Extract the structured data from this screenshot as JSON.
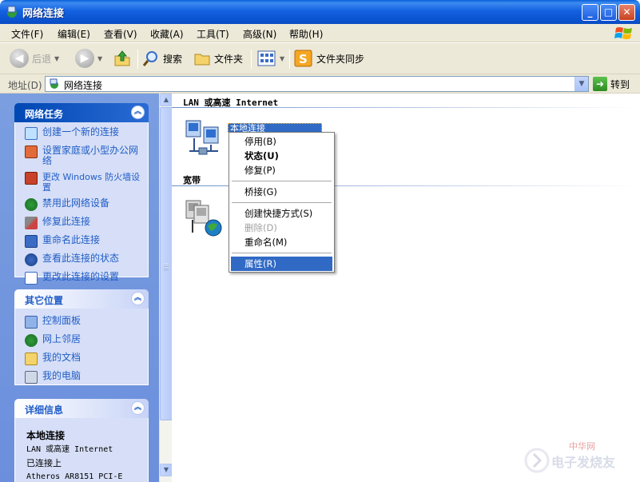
{
  "window": {
    "title": "网络连接"
  },
  "menu": [
    "文件(F)",
    "编辑(E)",
    "查看(V)",
    "收藏(A)",
    "工具(T)",
    "高级(N)",
    "帮助(H)"
  ],
  "toolbar": {
    "back": "后退",
    "search": "搜索",
    "folders": "文件夹",
    "sync": "文件夹同步"
  },
  "address": {
    "label": "地址(D)",
    "value": "网络连接",
    "go": "转到"
  },
  "network_tasks": {
    "title": "网络任务",
    "items": [
      "创建一个新的连接",
      "设置家庭或小型办公网络",
      "更改 Windows 防火墙设置",
      "禁用此网络设备",
      "修复此连接",
      "重命名此连接",
      "查看此连接的状态",
      "更改此连接的设置"
    ]
  },
  "other_places": {
    "title": "其它位置",
    "items": [
      "控制面板",
      "网上邻居",
      "我的文档",
      "我的电脑"
    ]
  },
  "details": {
    "title": "详细信息",
    "name": "本地连接",
    "type": "LAN 或高速 Internet",
    "status": "已连接上",
    "device": "Atheros AR8151 PCI-E"
  },
  "main": {
    "group_lan": "LAN 或高速 Internet",
    "group_broadband": "宽带",
    "lan_item_label": "本地连接"
  },
  "context_menu": [
    {
      "label": "停用(B)",
      "style": "normal"
    },
    {
      "label": "状态(U)",
      "style": "bold"
    },
    {
      "label": "修复(P)",
      "style": "normal"
    },
    {
      "label": "桥接(G)",
      "style": "normal"
    },
    {
      "label": "创建快捷方式(S)",
      "style": "normal"
    },
    {
      "label": "删除(D)",
      "style": "disabled"
    },
    {
      "label": "重命名(M)",
      "style": "normal"
    },
    {
      "label": "属性(R)",
      "style": "selected"
    }
  ],
  "watermark": "电子发烧友 中华网"
}
